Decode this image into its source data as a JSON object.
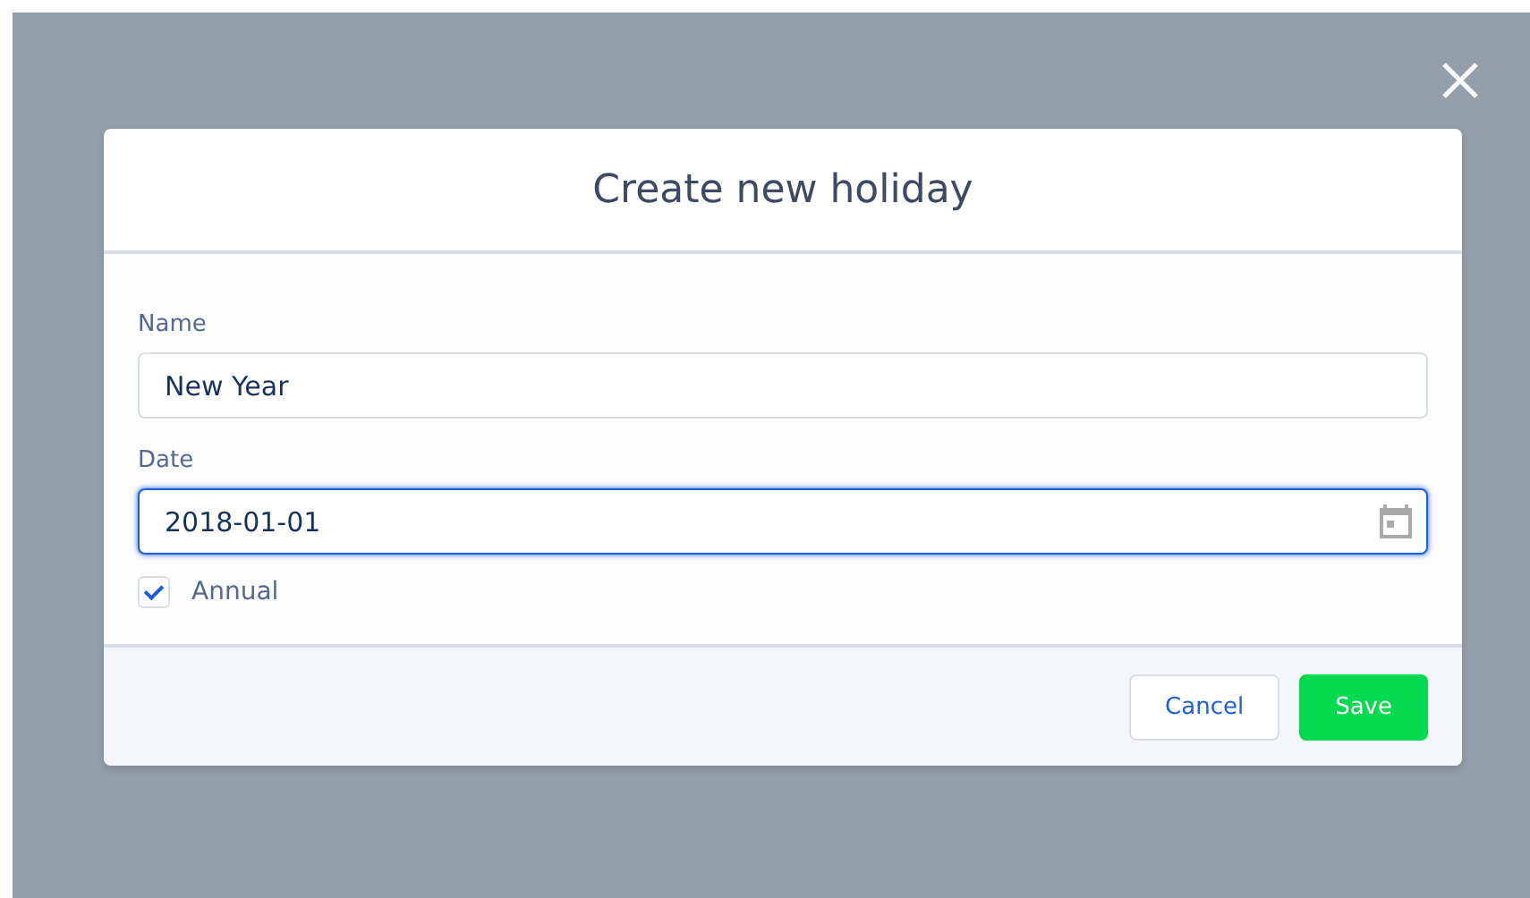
{
  "modal": {
    "title": "Create new holiday",
    "fields": [
      {
        "label": "Name",
        "value": "New Year",
        "kind": "text",
        "focused": false
      },
      {
        "label": "Date",
        "value": "2018-01-01",
        "kind": "date",
        "focused": true
      }
    ],
    "checkbox": {
      "label": "Annual",
      "checked": true
    },
    "buttons": [
      {
        "label": "Cancel",
        "kind": "neutral"
      },
      {
        "label": "Save",
        "kind": "brand"
      }
    ]
  }
}
